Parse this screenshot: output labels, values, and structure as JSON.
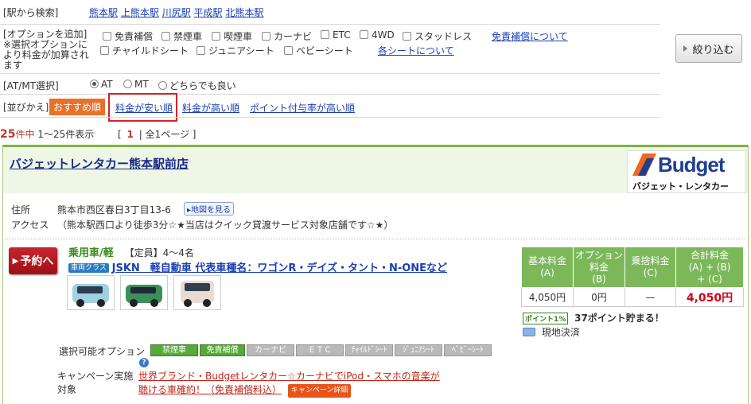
{
  "station_search": {
    "label": "[駅から検索]",
    "stations": [
      "熊本駅",
      "上熊本駅",
      "川尻駅",
      "平成駅",
      "北熊本駅"
    ]
  },
  "options": {
    "label": "[オプションを追加]",
    "note": "※選択オプションにより料金が加算されます",
    "row1": [
      "免責補償",
      "禁煙車",
      "喫煙車",
      "カーナビ",
      "ETC",
      "4WD",
      "スタッドレス"
    ],
    "row2": [
      "チャイルドシート",
      "ジュニアシート",
      "ベビーシート"
    ],
    "link_insurance": "免責補償について",
    "link_seats": "各シートについて",
    "filter_button": "絞り込む"
  },
  "transmission": {
    "label": "[AT/MT選択]",
    "choices": [
      "AT",
      "MT",
      "どちらでも良い"
    ],
    "selected": "AT"
  },
  "sort": {
    "label": "[並びかえ]",
    "active": "おすすめ順",
    "links": [
      "料金が安い順",
      "料金が高い順",
      "ポイント付与率が高い順"
    ]
  },
  "results": {
    "count": "25",
    "count_suffix": "件中",
    "range": "1〜25件表示",
    "pager_open": "[",
    "page": "1",
    "pager_rest": "| 全1ページ ]"
  },
  "shop": {
    "name": "バジェットレンタカー熊本駅前店",
    "logo_brand": "Budget",
    "logo_sub": "バジェット・レンタカー",
    "address_label": "住所",
    "address": "熊本市西区春日3丁目13-6",
    "map_button": "▸地図を見る",
    "access_label": "アクセス",
    "access": "（熊本駅西口より徒歩3分☆★当店はクイック貸渡サービス対象店舗です☆★）"
  },
  "plan": {
    "reserve_button": "予約へ",
    "car_type": "乗用車/軽",
    "capacity": "【定員】4〜4名",
    "class_badge": "車両クラス",
    "class_link": "JSKN　軽自動車 代表車種名：ワゴンR・デイズ・タント・N-ONEなど",
    "price_headers": [
      "基本料金\n(A)",
      "オプション料金\n(B)",
      "乗捨料金\n(C)",
      "合計料金\n(A) + (B)\n+ (C)"
    ],
    "price_values": [
      "4,050円",
      "0円",
      "—",
      "4,050円"
    ],
    "point_badge": "ポイント1%",
    "point_text": "37ポイント貯まる！",
    "payment": "現地決済",
    "option_label": "選択可能オプション",
    "option_tags": [
      {
        "label": "禁煙車",
        "on": true
      },
      {
        "label": "免責補償",
        "on": true
      },
      {
        "label": "カーナビ",
        "on": false
      },
      {
        "label": "ＥＴＣ",
        "on": false
      },
      {
        "label": "ﾁｬｲﾙﾄﾞｼｰﾄ",
        "on": false
      },
      {
        "label": "ｼﾞｭﾆｱｼｰﾄ",
        "on": false
      },
      {
        "label": "ﾍﾞﾋﾞｰｼｰﾄ",
        "on": false
      }
    ],
    "campaign_label": "キャンペーン実施対象",
    "campaign_text": "世界ブランド・Budgetレンタカー☆カーナビでiPod・スマホの音楽が聴ける車確約！（免責補償料込）",
    "campaign_badge": "キャンペーン詳細"
  },
  "colors": {
    "accent_orange": "#e8722a",
    "link_blue": "#1a3fb5",
    "green_header": "#7cb85a",
    "total_red": "#d0021b",
    "reserve_red": "#b01a1f",
    "budget_blue": "#1f3f8f",
    "budget_orange": "#f26522"
  }
}
